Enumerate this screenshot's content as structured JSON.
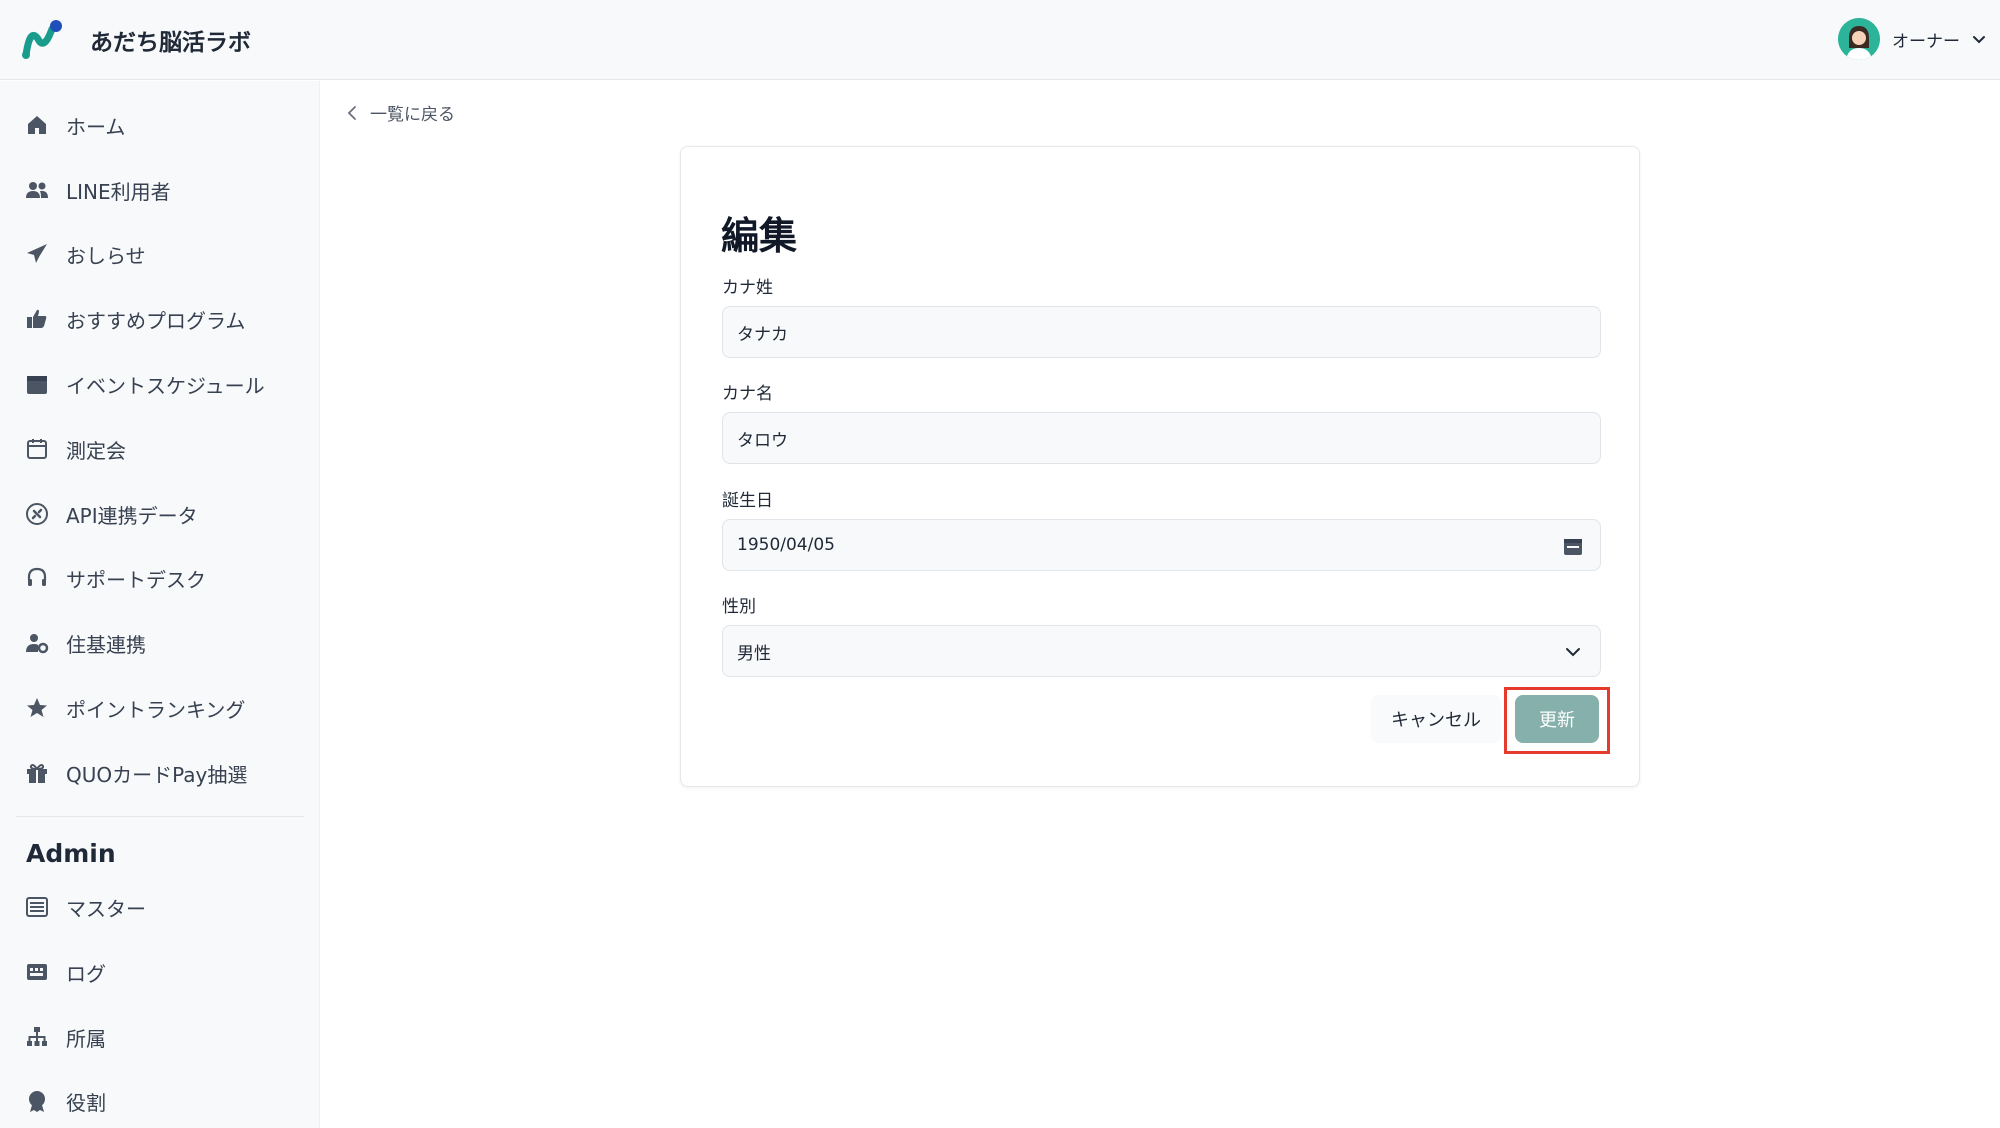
{
  "app": {
    "brand_name": "あだち脳活ラボ"
  },
  "header": {
    "user_name": "オーナー",
    "avatar_icon": "user-avatar-icon",
    "chevron_icon": "chevron-down-icon"
  },
  "sidebar": {
    "items": [
      {
        "label": "ホーム",
        "icon": "home-icon"
      },
      {
        "label": "LINE利用者",
        "icon": "users-icon"
      },
      {
        "label": "おしらせ",
        "icon": "paper-plane-icon"
      },
      {
        "label": "おすすめプログラム",
        "icon": "thumbs-up-icon"
      },
      {
        "label": "イベントスケジュール",
        "icon": "calendar-icon"
      },
      {
        "label": "測定会",
        "icon": "calendar-outline-icon"
      },
      {
        "label": "API連携データ",
        "icon": "plug-icon"
      },
      {
        "label": "サポートデスク",
        "icon": "headset-icon"
      },
      {
        "label": "住基連携",
        "icon": "user-gear-icon"
      },
      {
        "label": "ポイントランキング",
        "icon": "star-icon"
      },
      {
        "label": "QUOカードPay抽選",
        "icon": "gift-icon"
      }
    ],
    "admin_title": "Admin",
    "admin_items": [
      {
        "label": "マスター",
        "icon": "list-icon"
      },
      {
        "label": "ログ",
        "icon": "log-icon"
      },
      {
        "label": "所属",
        "icon": "sitemap-icon"
      },
      {
        "label": "役割",
        "icon": "award-icon"
      }
    ]
  },
  "main": {
    "back_label": "一覧に戻る",
    "form": {
      "title": "編集",
      "fields": [
        {
          "label": "カナ姓",
          "value": "タナカ"
        },
        {
          "label": "カナ名",
          "value": "タロウ"
        },
        {
          "label": "誕生日",
          "value": "1950/04/05",
          "icon": "calendar-icon"
        },
        {
          "label": "性別",
          "value": "男性",
          "icon": "chevron-down-icon"
        }
      ],
      "cancel_label": "キャンセル",
      "update_label": "更新"
    }
  },
  "colors": {
    "accent": "#86b0ab",
    "highlight": "#e53b2c",
    "sidebar_bg": "#f8f9fa"
  }
}
